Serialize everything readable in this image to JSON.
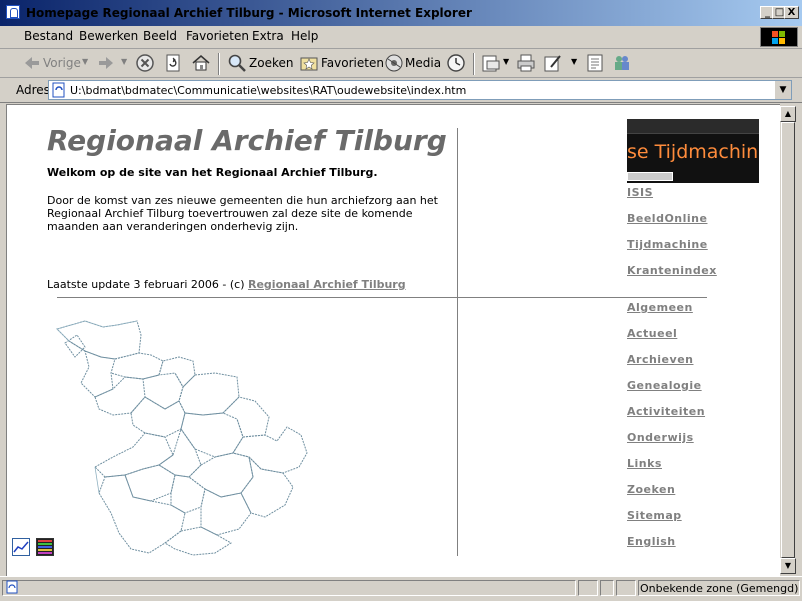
{
  "window": {
    "title": "Homepage Regionaal Archief Tilburg - Microsoft Internet Explorer",
    "minimize": "_",
    "maximize": "□",
    "close": "X"
  },
  "menu": {
    "items": [
      "Bestand",
      "Bewerken",
      "Beeld",
      "Favorieten",
      "Extra",
      "Help"
    ]
  },
  "toolbar": {
    "back_label": "Vorige",
    "search_label": "Zoeken",
    "favorites_label": "Favorieten",
    "media_label": "Media"
  },
  "addressbar": {
    "label": "Adres",
    "url": "U:\\bdmat\\bdmatec\\Communicatie\\websites\\RAT\\oudewebsite\\index.htm"
  },
  "page": {
    "heading": "Regionaal Archief Tilburg",
    "welcome": "Welkom op de site van het Regionaal Archief Tilburg.",
    "intro": "Door de komst van zes nieuwe gemeenten die hun archiefzorg aan het Regionaal Archief Tilburg toevertrouwen zal deze site de komende maanden aan veranderingen onderhevig zijn.",
    "update_prefix": "Laatste update 3 februari 2006 - (c) ",
    "update_link": "Regionaal Archief Tilburg",
    "banner_text": "se Tijdmachine"
  },
  "nav": {
    "top": [
      "ISIS",
      "BeeldOnline",
      "Tijdmachine",
      "Krantenindex"
    ],
    "main": [
      "Algemeen",
      "Actueel",
      "Archieven",
      "Genealogie",
      "Activiteiten",
      "Onderwijs",
      "Links",
      "Zoeken",
      "Sitemap",
      "English"
    ]
  },
  "status": {
    "zone": "Onbekende zone (Gemengd)"
  }
}
